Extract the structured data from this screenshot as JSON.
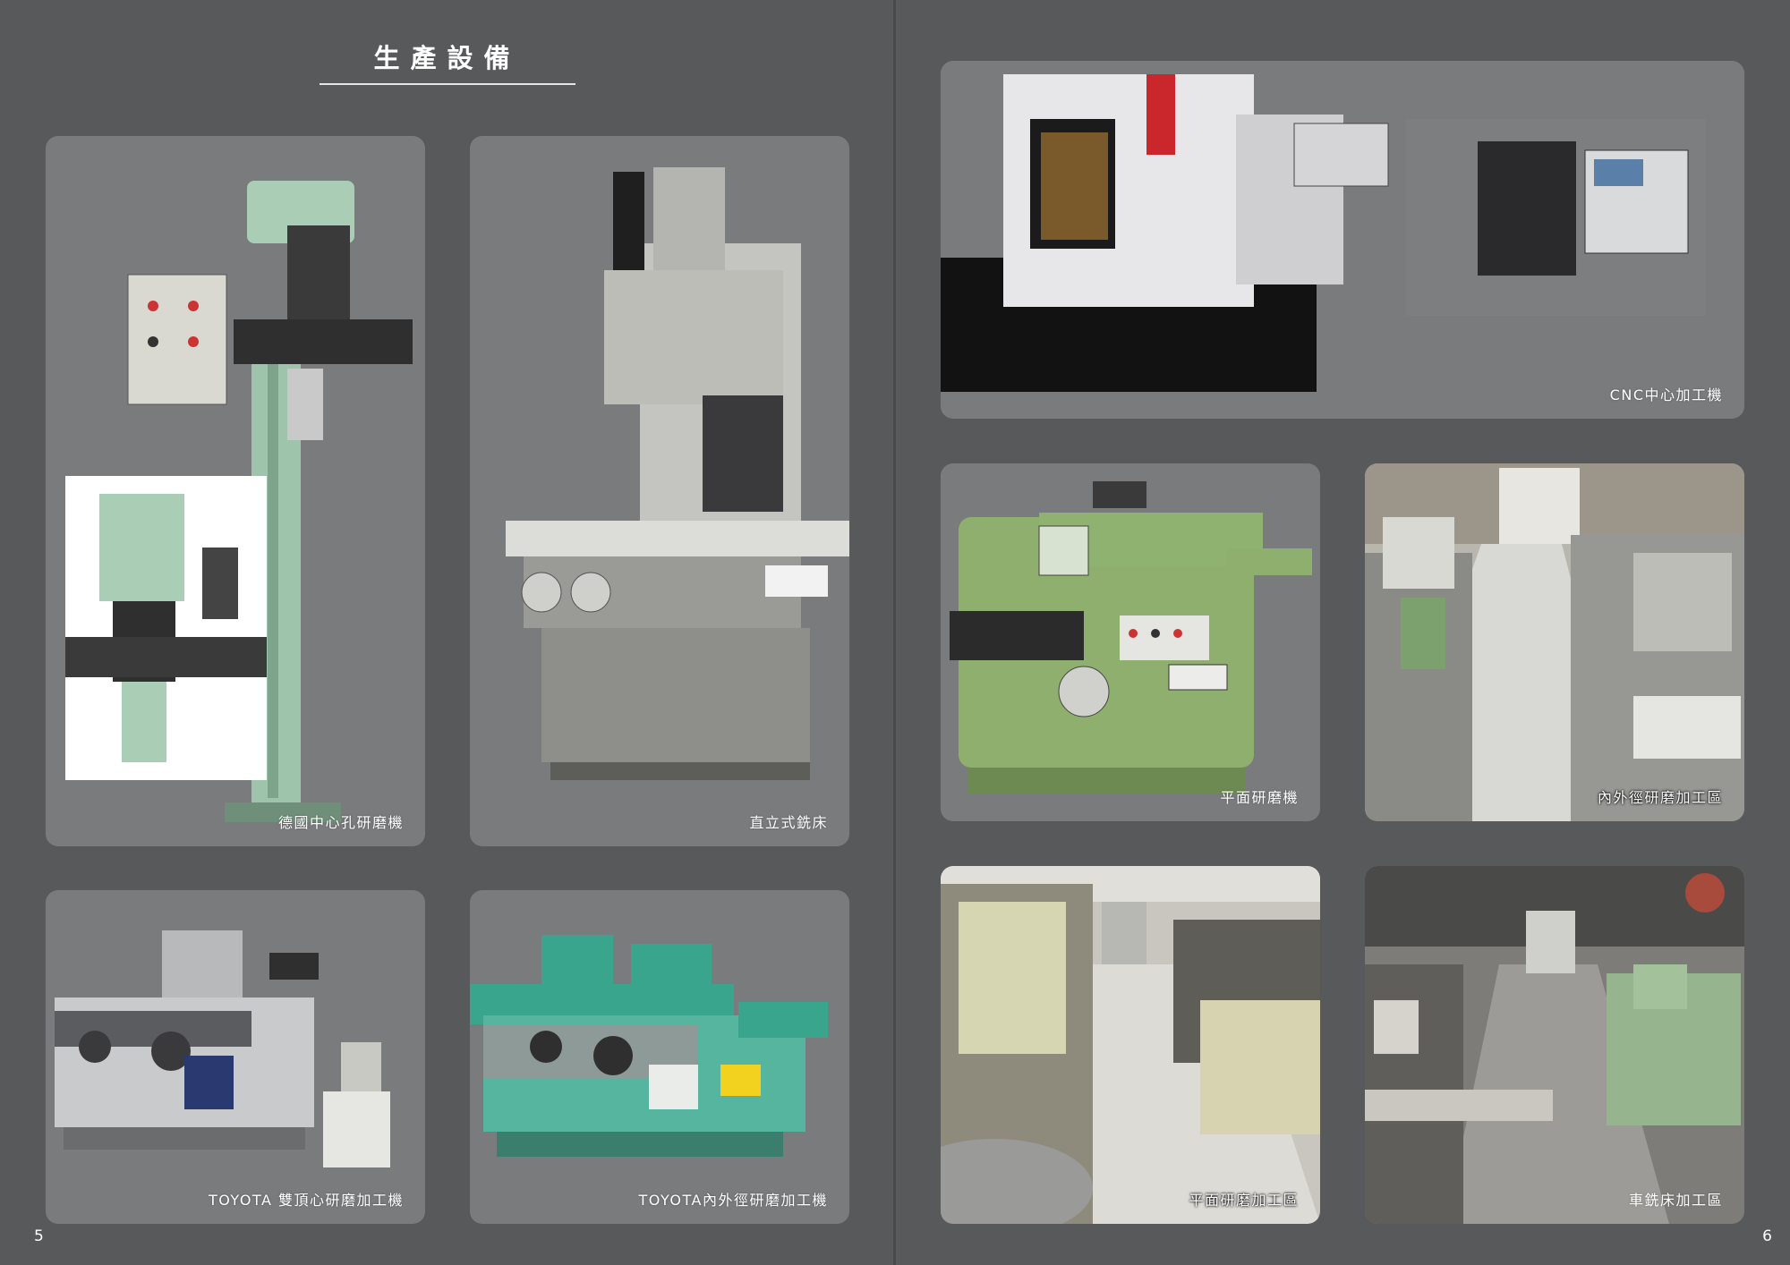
{
  "title": "生產設備",
  "page_left": "5",
  "page_right": "6",
  "cards": [
    {
      "caption": "德國中心孔研磨機",
      "image": "center-hole-grinder-photo"
    },
    {
      "caption": "直立式銑床",
      "image": "vertical-milling-machine-photo"
    },
    {
      "caption": "TOYOTA 雙頂心研磨加工機",
      "image": "toyota-dual-center-grinder-photo"
    },
    {
      "caption": "TOYOTA內外徑研磨加工機",
      "image": "toyota-id-od-grinder-photo"
    },
    {
      "caption": "CNC中心加工機",
      "image": "cnc-machining-center-photo"
    },
    {
      "caption": "平面研磨機",
      "image": "surface-grinder-photo"
    },
    {
      "caption": "內外徑研磨加工區",
      "image": "id-od-grinding-area-photo"
    },
    {
      "caption": "平面研磨加工區",
      "image": "surface-grinding-area-photo"
    },
    {
      "caption": "車銑床加工區",
      "image": "lathe-milling-area-photo"
    }
  ]
}
